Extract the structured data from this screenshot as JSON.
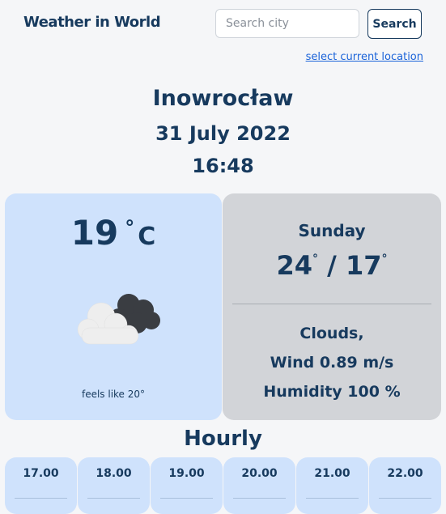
{
  "header": {
    "app_title": "Weather in World",
    "search_placeholder": "Search city",
    "search_button": "Search",
    "location_link": "select current location"
  },
  "location": {
    "city": "Inowrocław",
    "date": "31 July 2022",
    "time": "16:48"
  },
  "current": {
    "temperature": "19",
    "degree_symbol": "°",
    "unit": "C",
    "condition_icon": "cloudy-icon",
    "feels_like": "feels like 20°"
  },
  "daily": {
    "day": "Sunday",
    "max_temp": "24",
    "min_temp": "17",
    "separator": "/",
    "degree_symbol": "°",
    "description": "Clouds,",
    "wind": "Wind 0.89 m/s",
    "humidity": "Humidity 100 %"
  },
  "hourly": {
    "title": "Hourly",
    "hours": [
      "17.00",
      "18.00",
      "19.00",
      "20.00",
      "21.00",
      "22.00"
    ]
  },
  "colors": {
    "text": "#173a5e",
    "link": "#1a63d9",
    "card_blue": "#cfe2fc",
    "card_gray": "#d2d4d8",
    "background": "#f5f6f8"
  }
}
